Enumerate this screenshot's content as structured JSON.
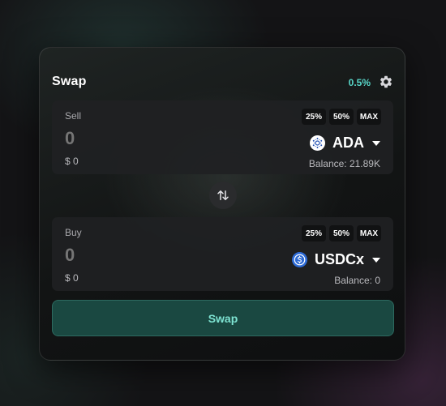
{
  "header": {
    "title": "Swap",
    "slippage": "0.5%",
    "settings_icon": "gear-icon"
  },
  "colors": {
    "accent": "#58d6c8",
    "swap_button_bg": "#1a4841",
    "swap_button_text": "#7ee3d2",
    "panel_bg": "#202123"
  },
  "sell": {
    "label": "Sell",
    "amount_placeholder": "0",
    "usd_value": "$ 0",
    "percent_buttons": [
      "25%",
      "50%",
      "MAX"
    ],
    "token": "ADA",
    "token_icon": "cardano-icon",
    "balance": "Balance: 21.89K"
  },
  "switch_icon": "swap-arrows-icon",
  "buy": {
    "label": "Buy",
    "amount_placeholder": "0",
    "usd_value": "$ 0",
    "percent_buttons": [
      "25%",
      "50%",
      "MAX"
    ],
    "token": "USDCx",
    "token_icon": "usdc-icon",
    "balance": "Balance: 0"
  },
  "action": {
    "swap_label": "Swap"
  }
}
